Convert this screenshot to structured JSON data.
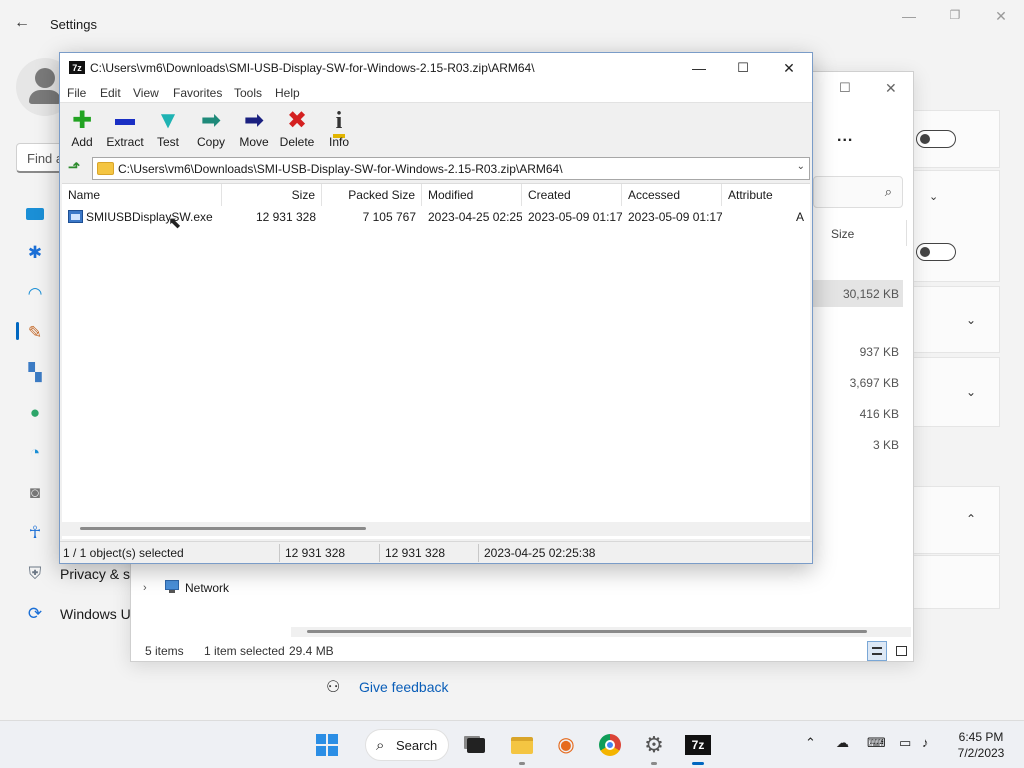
{
  "settings": {
    "title": "Settings",
    "find_placeholder": "Find a",
    "nav_partial": [
      "Privacy & s",
      "Windows U"
    ],
    "feedback": "Give feedback"
  },
  "explorer": {
    "more": "...",
    "col_size": "Size",
    "sizes": [
      "30,152 KB",
      "937 KB",
      "3,697 KB",
      "416 KB",
      "3 KB"
    ],
    "network": "Network",
    "status_items": "5 items",
    "status_selected": "1 item selected",
    "status_size": "29.4 MB"
  },
  "zip": {
    "app_icon": "7z",
    "title": "C:\\Users\\vm6\\Downloads\\SMI-USB-Display-SW-for-Windows-2.15-R03.zip\\ARM64\\",
    "menu": [
      "File",
      "Edit",
      "View",
      "Favorites",
      "Tools",
      "Help"
    ],
    "tools": [
      {
        "label": "Add",
        "icon": "add-icon"
      },
      {
        "label": "Extract",
        "icon": "extract-icon"
      },
      {
        "label": "Test",
        "icon": "test-icon"
      },
      {
        "label": "Copy",
        "icon": "copy-icon"
      },
      {
        "label": "Move",
        "icon": "move-icon"
      },
      {
        "label": "Delete",
        "icon": "delete-icon"
      },
      {
        "label": "Info",
        "icon": "info-icon"
      }
    ],
    "address": "C:\\Users\\vm6\\Downloads\\SMI-USB-Display-SW-for-Windows-2.15-R03.zip\\ARM64\\",
    "columns": [
      "Name",
      "Size",
      "Packed Size",
      "Modified",
      "Created",
      "Accessed",
      "Attribute"
    ],
    "rows": [
      {
        "name": "SMIUSBDisplaySW.exe",
        "size": "12 931 328",
        "packed": "7 105 767",
        "modified": "2023-04-25 02:25",
        "created": "2023-05-09 01:17",
        "accessed": "2023-05-09 01:17",
        "attribute": "A"
      }
    ],
    "status": {
      "selected": "1 / 1 object(s) selected",
      "size": "12 931 328",
      "packed": "12 931 328",
      "modified": "2023-04-25 02:25:38"
    }
  },
  "taskbar": {
    "search_label": "Search",
    "app_7z": "7z",
    "time": "6:45 PM",
    "date": "7/2/2023"
  },
  "colors": {
    "accent": "#0067c0",
    "link": "#0a5eb8"
  }
}
